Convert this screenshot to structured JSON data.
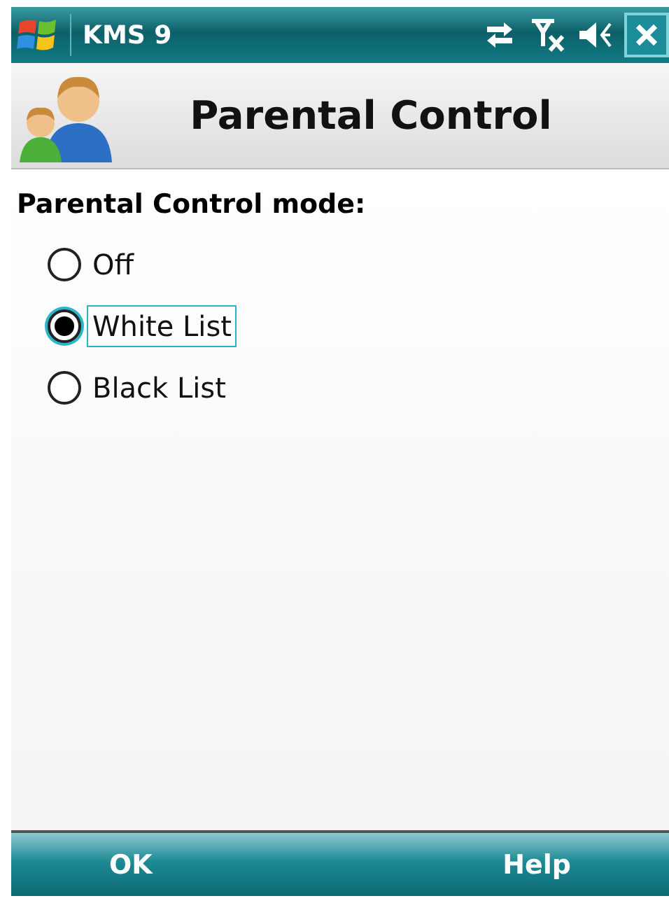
{
  "status_bar": {
    "title": "KMS 9"
  },
  "header": {
    "title": "Parental Control"
  },
  "mode": {
    "label": "Parental Control mode:",
    "options": [
      {
        "label": "Off",
        "selected": false,
        "focused": false
      },
      {
        "label": "White List",
        "selected": true,
        "focused": true
      },
      {
        "label": "Black List",
        "selected": false,
        "focused": false
      }
    ]
  },
  "softkeys": {
    "left": "OK",
    "right": "Help"
  }
}
